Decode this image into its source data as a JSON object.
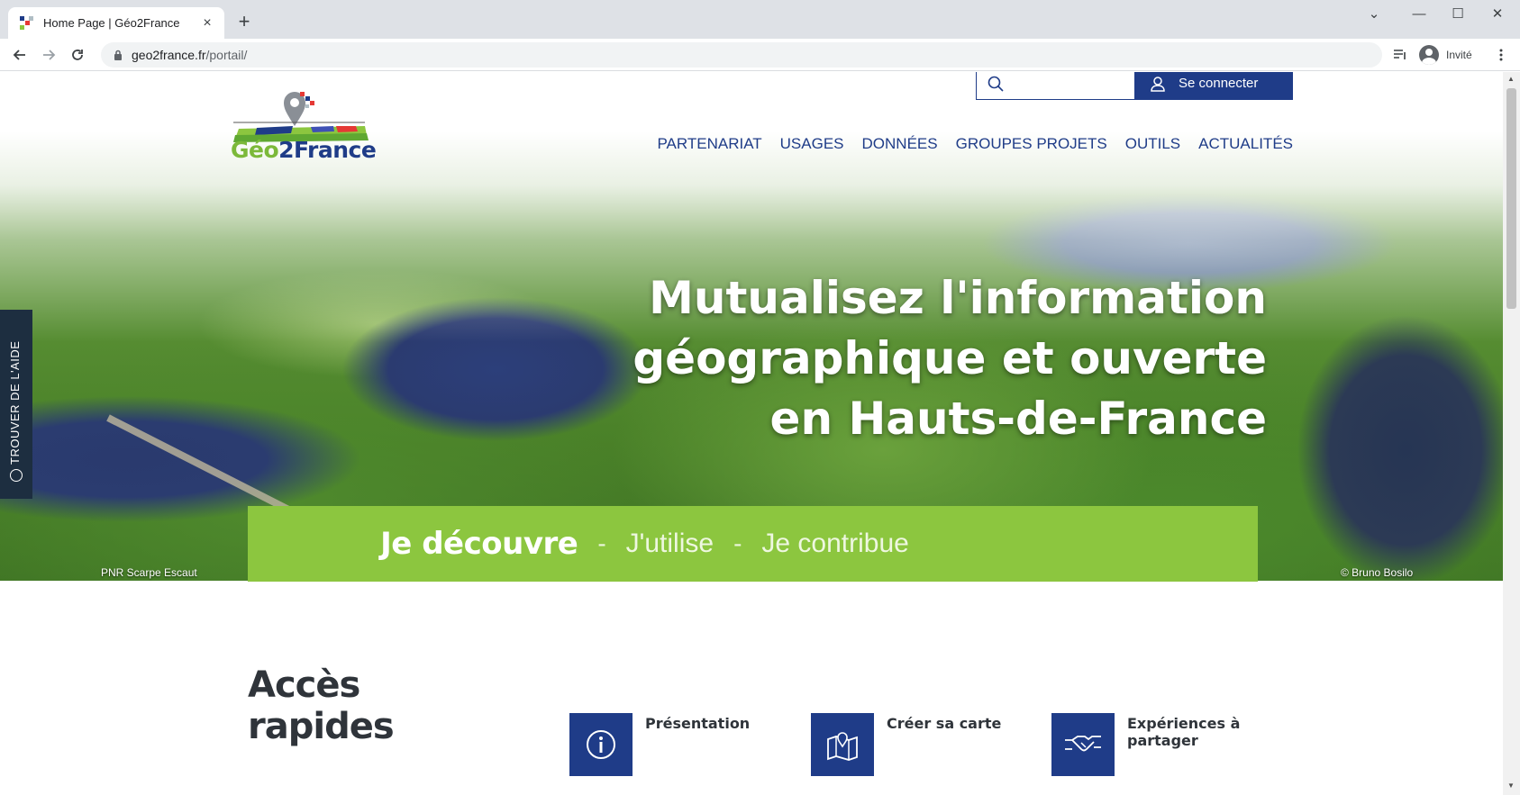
{
  "browser": {
    "tab_title": "Home Page | Géo2France",
    "tab_close": "×",
    "new_tab": "+",
    "url_host": "geo2france.fr",
    "url_path": "/portail/",
    "profile_label": "Invité",
    "window_controls": [
      "⌄",
      "—",
      "☐",
      "✕"
    ]
  },
  "header": {
    "logo_part1": "Géo",
    "logo_part2": "2France",
    "search_placeholder": "",
    "login_label": "Se connecter",
    "menu": [
      "PARTENARIAT",
      "USAGES",
      "DONNÉES",
      "GROUPES PROJETS",
      "OUTILS",
      "ACTUALITÉS"
    ]
  },
  "hero": {
    "title": "Mutualisez l'information\ngéographique et ouverte\nen Hauts-de-France",
    "credit_left": "PNR Scarpe Escaut",
    "credit_right": "© Bruno Bosilo"
  },
  "help_tab": {
    "label": "TROUVER DE L'AIDE"
  },
  "band": {
    "item1": "Je découvre",
    "separator": "-",
    "item2": "J'utilise",
    "item3": "Je contribue"
  },
  "quick_access": {
    "title": "Accès rapides",
    "items": [
      {
        "label": "Présentation",
        "icon": "info-icon"
      },
      {
        "label": "Créer sa carte",
        "icon": "map-pin-icon"
      },
      {
        "label": "Expériences à partager",
        "icon": "handshake-icon"
      }
    ]
  },
  "colors": {
    "brand_blue": "#1f3c88",
    "brand_green": "#8cc63f",
    "help_tab": "#1d2e40"
  }
}
